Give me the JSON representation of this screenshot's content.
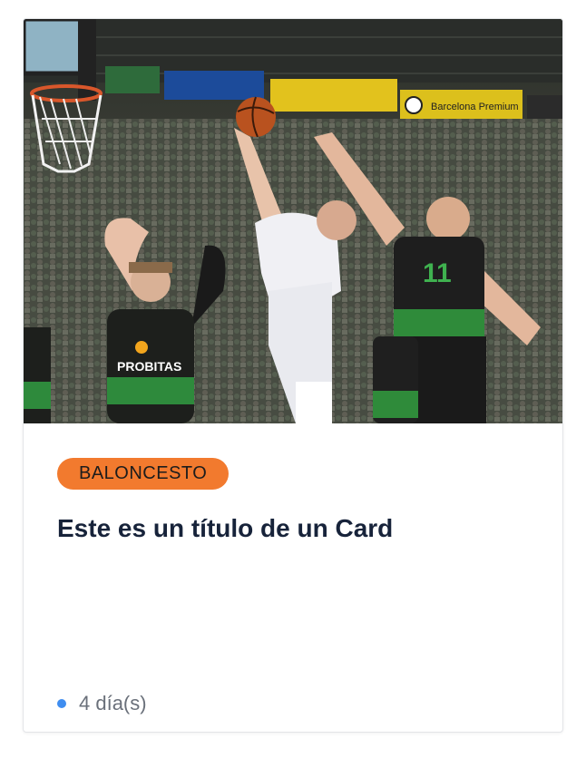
{
  "card": {
    "image": {
      "scene": "basketball-game-photo",
      "banners": [
        "Barcelona Premium"
      ],
      "jersey_number": "11",
      "jersey_text": "PROBITAS"
    },
    "category": "BALONCESTO",
    "title": "Este es un título de un Card",
    "time_ago": "4 día(s)"
  },
  "colors": {
    "badge": "#f27a2e",
    "title": "#17233a",
    "meta_text": "#6a707a",
    "meta_dot": "#3f8df0"
  }
}
